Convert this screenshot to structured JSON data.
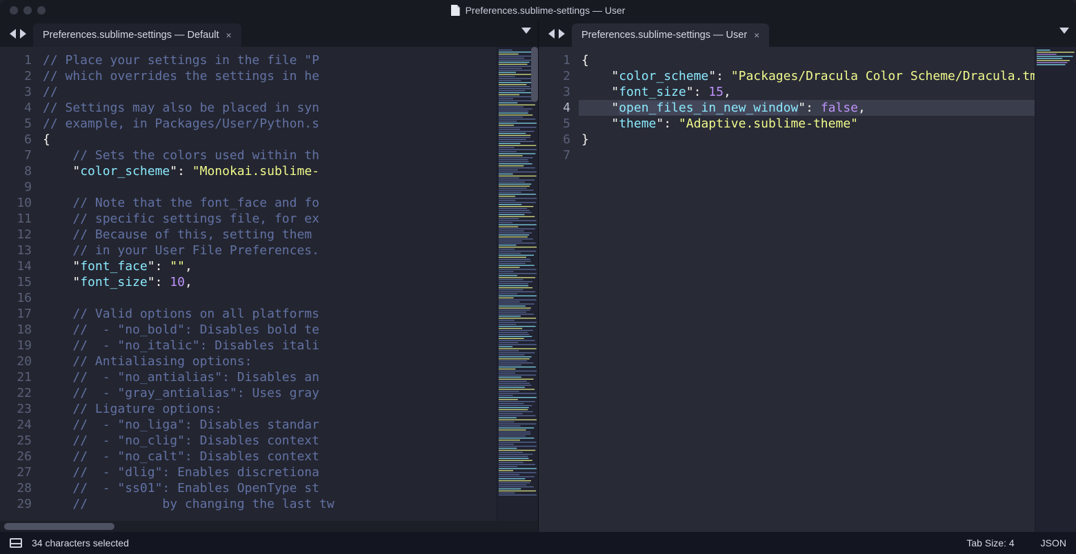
{
  "window": {
    "title": "Preferences.sublime-settings — User"
  },
  "panes": {
    "left": {
      "tab_title": "Preferences.sublime-settings — Default",
      "lines": [
        {
          "n": 1,
          "tokens": [
            [
              "cmt",
              "// Place your settings in the file \"P"
            ]
          ]
        },
        {
          "n": 2,
          "tokens": [
            [
              "cmt",
              "// which overrides the settings in he"
            ]
          ]
        },
        {
          "n": 3,
          "tokens": [
            [
              "cmt",
              "//"
            ]
          ]
        },
        {
          "n": 4,
          "tokens": [
            [
              "cmt",
              "// Settings may also be placed in syn"
            ]
          ]
        },
        {
          "n": 5,
          "tokens": [
            [
              "cmt",
              "// example, in Packages/User/Python.s"
            ]
          ]
        },
        {
          "n": 6,
          "tokens": [
            [
              "pun",
              "{"
            ]
          ]
        },
        {
          "n": 7,
          "indent": 4,
          "tokens": [
            [
              "cmt",
              "// Sets the colors used within th"
            ]
          ]
        },
        {
          "n": 8,
          "indent": 4,
          "tokens": [
            [
              "pun",
              "\""
            ],
            [
              "key",
              "color_scheme"
            ],
            [
              "pun",
              "\": "
            ],
            [
              "str",
              "\"Monokai.sublime-"
            ]
          ]
        },
        {
          "n": 9,
          "tokens": []
        },
        {
          "n": 10,
          "indent": 4,
          "tokens": [
            [
              "cmt",
              "// Note that the font_face and fo"
            ]
          ]
        },
        {
          "n": 11,
          "indent": 4,
          "tokens": [
            [
              "cmt",
              "// specific settings file, for ex"
            ]
          ]
        },
        {
          "n": 12,
          "indent": 4,
          "tokens": [
            [
              "cmt",
              "// Because of this, setting them "
            ]
          ]
        },
        {
          "n": 13,
          "indent": 4,
          "tokens": [
            [
              "cmt",
              "// in your User File Preferences."
            ]
          ]
        },
        {
          "n": 14,
          "indent": 4,
          "tokens": [
            [
              "pun",
              "\""
            ],
            [
              "key",
              "font_face"
            ],
            [
              "pun",
              "\": "
            ],
            [
              "str",
              "\"\""
            ],
            [
              "pun",
              ","
            ]
          ]
        },
        {
          "n": 15,
          "indent": 4,
          "tokens": [
            [
              "pun",
              "\""
            ],
            [
              "key",
              "font_size"
            ],
            [
              "pun",
              "\": "
            ],
            [
              "num",
              "10"
            ],
            [
              "pun",
              ","
            ]
          ]
        },
        {
          "n": 16,
          "tokens": []
        },
        {
          "n": 17,
          "indent": 4,
          "tokens": [
            [
              "cmt",
              "// Valid options on all platforms"
            ]
          ]
        },
        {
          "n": 18,
          "indent": 4,
          "tokens": [
            [
              "cmt",
              "//  - \"no_bold\": Disables bold te"
            ]
          ]
        },
        {
          "n": 19,
          "indent": 4,
          "tokens": [
            [
              "cmt",
              "//  - \"no_italic\": Disables itali"
            ]
          ]
        },
        {
          "n": 20,
          "indent": 4,
          "tokens": [
            [
              "cmt",
              "// Antialiasing options:"
            ]
          ]
        },
        {
          "n": 21,
          "indent": 4,
          "tokens": [
            [
              "cmt",
              "//  - \"no_antialias\": Disables an"
            ]
          ]
        },
        {
          "n": 22,
          "indent": 4,
          "tokens": [
            [
              "cmt",
              "//  - \"gray_antialias\": Uses gray"
            ]
          ]
        },
        {
          "n": 23,
          "indent": 4,
          "tokens": [
            [
              "cmt",
              "// Ligature options:"
            ]
          ]
        },
        {
          "n": 24,
          "indent": 4,
          "tokens": [
            [
              "cmt",
              "//  - \"no_liga\": Disables standar"
            ]
          ]
        },
        {
          "n": 25,
          "indent": 4,
          "tokens": [
            [
              "cmt",
              "//  - \"no_clig\": Disables context"
            ]
          ]
        },
        {
          "n": 26,
          "indent": 4,
          "tokens": [
            [
              "cmt",
              "//  - \"no_calt\": Disables context"
            ]
          ]
        },
        {
          "n": 27,
          "indent": 4,
          "tokens": [
            [
              "cmt",
              "//  - \"dlig\": Enables discretiona"
            ]
          ]
        },
        {
          "n": 28,
          "indent": 4,
          "tokens": [
            [
              "cmt",
              "//  - \"ss01\": Enables OpenType st"
            ]
          ]
        },
        {
          "n": 29,
          "indent": 4,
          "tokens": [
            [
              "cmt",
              "//          by changing the last tw"
            ]
          ]
        }
      ]
    },
    "right": {
      "tab_title": "Preferences.sublime-settings — User",
      "active_line": 4,
      "lines": [
        {
          "n": 1,
          "tokens": [
            [
              "pun",
              "{"
            ]
          ]
        },
        {
          "n": 2,
          "indent": 4,
          "tokens": [
            [
              "pun",
              "\""
            ],
            [
              "key",
              "color_scheme"
            ],
            [
              "pun",
              "\": "
            ],
            [
              "str",
              "\"Packages/Dracula Color Scheme/Dracula.tmTheme\""
            ],
            [
              "pun",
              ","
            ]
          ]
        },
        {
          "n": 3,
          "indent": 4,
          "tokens": [
            [
              "pun",
              "\""
            ],
            [
              "key",
              "font_size"
            ],
            [
              "pun",
              "\": "
            ],
            [
              "num",
              "15"
            ],
            [
              "pun",
              ","
            ]
          ]
        },
        {
          "n": 4,
          "indent": 4,
          "tokens": [
            [
              "pun",
              "\""
            ],
            [
              "keysel",
              "open_files_in_new_window"
            ],
            [
              "pun",
              "\": "
            ],
            [
              "bool",
              "false"
            ],
            [
              "pun",
              ","
            ]
          ]
        },
        {
          "n": 5,
          "indent": 4,
          "tokens": [
            [
              "pun",
              "\""
            ],
            [
              "key",
              "theme"
            ],
            [
              "pun",
              "\": "
            ],
            [
              "str",
              "\"Adaptive.sublime-theme\""
            ]
          ]
        },
        {
          "n": 6,
          "tokens": [
            [
              "pun",
              "}"
            ]
          ]
        },
        {
          "n": 7,
          "tokens": []
        }
      ]
    }
  },
  "status": {
    "selection": "34 characters selected",
    "tab_size": "Tab Size: 4",
    "syntax": "JSON"
  }
}
